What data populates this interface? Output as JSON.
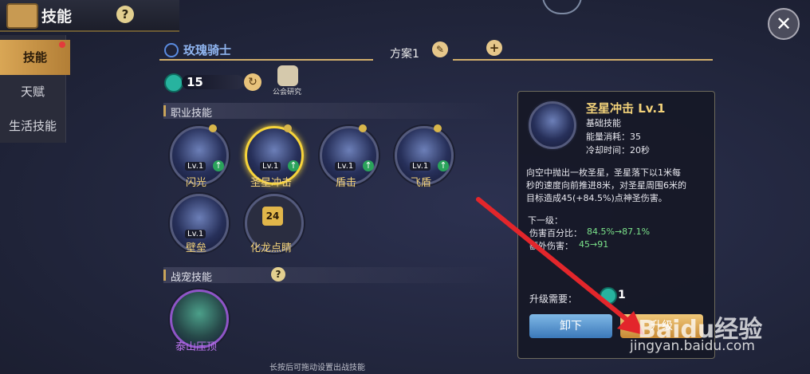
{
  "header": {
    "title": "技能"
  },
  "tabs": [
    {
      "label": "技能"
    },
    {
      "label": "天赋"
    },
    {
      "label": "生活技能"
    }
  ],
  "character": {
    "class_name": "玫瑰骑士"
  },
  "plan": {
    "label": "方案1"
  },
  "points": {
    "value": "15"
  },
  "guild": {
    "label": "公会研究"
  },
  "sections": {
    "class_skills": "职业技能",
    "pet_skills": "战宠技能"
  },
  "skills": [
    {
      "name": "闪光",
      "level": "Lv.1"
    },
    {
      "name": "圣星冲击",
      "level": "Lv.1"
    },
    {
      "name": "盾击",
      "level": "Lv.1"
    },
    {
      "name": "飞盾",
      "level": "Lv.1"
    },
    {
      "name": "壁垒",
      "level": "Lv.1"
    },
    {
      "name": "化龙点睛",
      "lock_level": "24"
    }
  ],
  "pet_skill": {
    "name": "泰山压顶"
  },
  "footer_hint": "长按后可拖动设置出战技能",
  "detail": {
    "title": "圣星冲击 Lv.1",
    "type": "基础技能",
    "energy": "能量消耗：35",
    "cooldown": "冷却时间：20秒",
    "desc_1": "向空中抛出一枚圣星，圣星落下以1米每",
    "desc_2": "秒的速度向前推进8米，对圣星周围6米的",
    "desc_3": "目标造成45(+84.5%)点神圣伤害。",
    "next_level": "下一级：",
    "dmg_pct_label": "伤害百分比：",
    "dmg_pct_value": "84.5%→87.1%",
    "extra_dmg_label": "额外伤害：",
    "extra_dmg_value": "45→91",
    "upgrade_label": "升级需要：",
    "upgrade_value": "1",
    "unequip": "卸下",
    "upgrade_btn": "升级"
  },
  "watermark": {
    "brand": "Baidu经验",
    "url": "jingyan.baidu.com"
  },
  "colors": {
    "gold": "#f3d27a",
    "green": "#2aa35b",
    "blue_btn": "#3b78b9",
    "highlight": "#f7d43a"
  }
}
